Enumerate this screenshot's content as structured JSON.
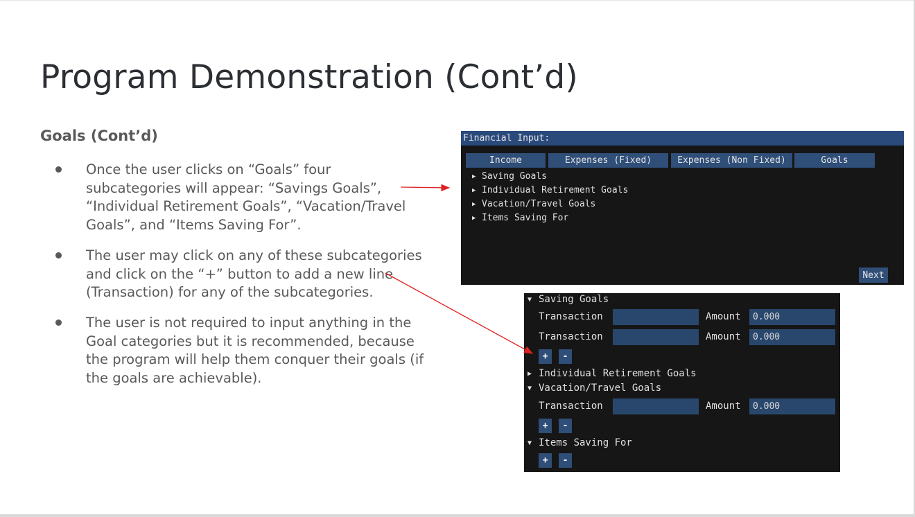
{
  "slide": {
    "title": "Program Demonstration (Cont’d)",
    "subtitle": "Goals (Cont’d)",
    "bullets": [
      "Once the user clicks on “Goals” four subcategories will appear: “Savings Goals”, “Individual Retirement Goals”, “Vacation/Travel Goals”, and “Items Saving For”.",
      "The user may click on any of these subcategories and click on the “+” button to add a new line (Transaction) for any of the subcategories.",
      "The user is not required to input anything in the Goal categories but it is recommended, because the program will help them conquer their goals (if the goals are achievable)."
    ]
  },
  "financial_input": {
    "window_title": "Financial Input:",
    "tabs": [
      "Income",
      "Expenses (Fixed)",
      "Expenses (Non Fixed)",
      "Goals"
    ],
    "subcategories": [
      "Saving Goals",
      "Individual Retirement Goals",
      "Vacation/Travel Goals",
      "Items Saving For"
    ],
    "next_label": "Next"
  },
  "goals_detail": {
    "sections": [
      {
        "name": "Saving Goals",
        "expanded": true,
        "rows": [
          {
            "label": "Transaction",
            "transaction": "",
            "amount_label": "Amount",
            "amount": "0.000"
          },
          {
            "label": "Transaction",
            "transaction": "",
            "amount_label": "Amount",
            "amount": "0.000"
          }
        ]
      },
      {
        "name": "Individual Retirement Goals",
        "expanded": false,
        "rows": []
      },
      {
        "name": "Vacation/Travel Goals",
        "expanded": true,
        "rows": [
          {
            "label": "Transaction",
            "transaction": "",
            "amount_label": "Amount",
            "amount": "0.000"
          }
        ]
      },
      {
        "name": "Items Saving For",
        "expanded": true,
        "rows": []
      }
    ],
    "add_label": "+",
    "remove_label": "-"
  },
  "icons": {
    "expanded": "triangle-down-icon",
    "collapsed": "triangle-right-icon"
  },
  "colors": {
    "annotation_arrow": "#e02020",
    "window_title_bar": "#2b4a7c",
    "button": "#2f4e78",
    "input_field": "#29476d",
    "panel_bg": "#161616"
  }
}
